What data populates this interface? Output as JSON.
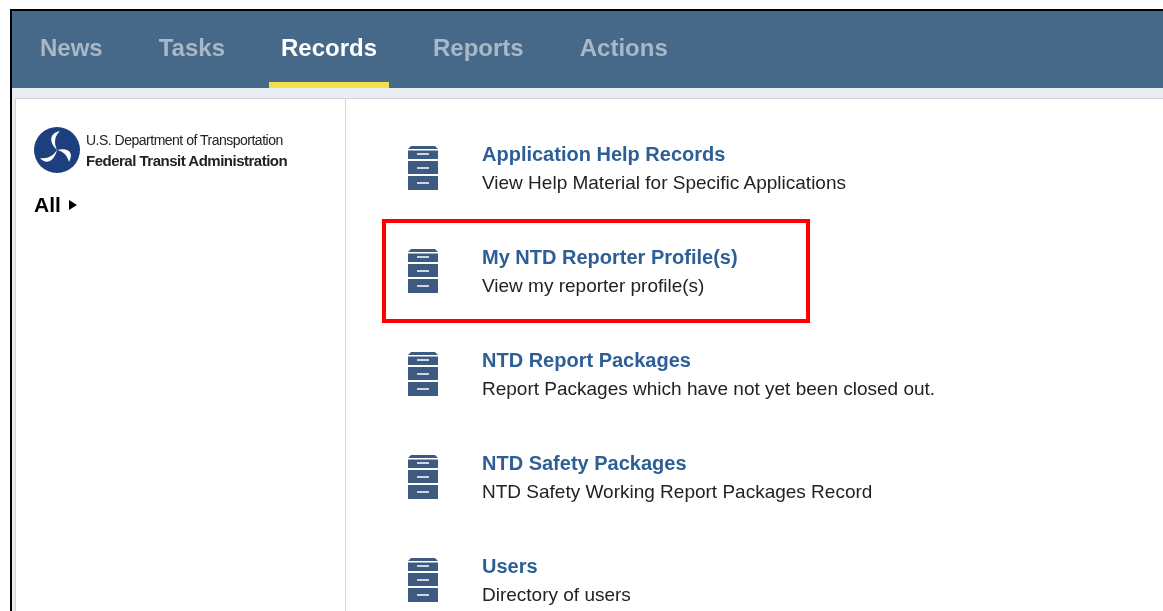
{
  "tabs": [
    {
      "label": "News",
      "selected": false
    },
    {
      "label": "Tasks",
      "selected": false
    },
    {
      "label": "Records",
      "selected": true
    },
    {
      "label": "Reports",
      "selected": false
    },
    {
      "label": "Actions",
      "selected": false
    }
  ],
  "sidebar": {
    "logo": {
      "line_1": "U.S. Department of Transportation",
      "line_2": "Federal Transit Administration"
    },
    "filter": "All"
  },
  "records": [
    {
      "title": "Application Help Records",
      "description": "View Help Material for Specific Applications",
      "highlighted": false
    },
    {
      "title": "My NTD Reporter Profile(s)",
      "description": "View my reporter profile(s)",
      "highlighted": true
    },
    {
      "title": "NTD Report Packages",
      "description": "Report Packages which have not yet been closed out.",
      "highlighted": false
    },
    {
      "title": "NTD Safety Packages",
      "description": "NTD Safety Working Report Packages Record",
      "highlighted": false
    },
    {
      "title": "Users",
      "description": "Directory of users",
      "highlighted": false
    }
  ]
}
